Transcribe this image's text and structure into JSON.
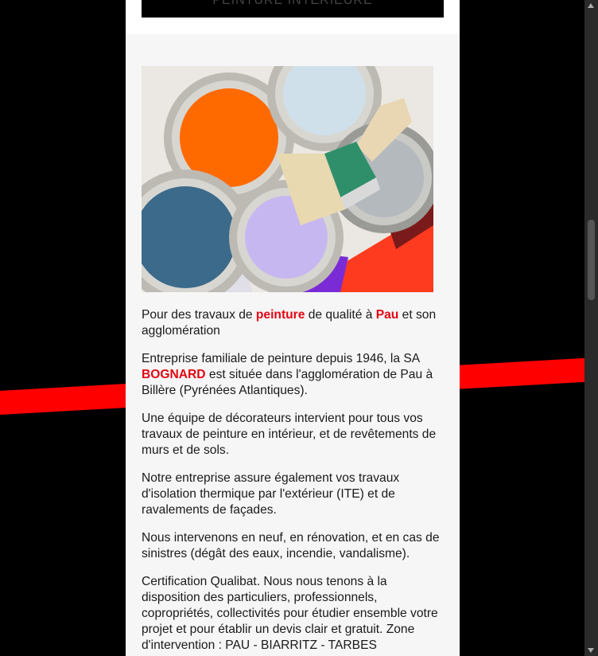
{
  "top_button": {
    "label": "PEINTURE INTÉRIEURE"
  },
  "hero_image": {
    "alt": "Pots de peinture et pinceau"
  },
  "content": {
    "p1": {
      "t1": "Pour des travaux de ",
      "h1": "peinture",
      "t2": " de qualité à ",
      "h2": "Pau",
      "t3": " et son agglomération"
    },
    "p2": {
      "t1": "Entreprise familiale de peinture depuis 1946, la SA ",
      "h1": "BOGNARD",
      "t2": " est située dans l'agglomération de Pau à Billère (Pyrénées Atlantiques)."
    },
    "p3": "Une équipe de décorateurs intervient pour tous vos travaux de peinture en intérieur, et de revêtements de murs et de sols.",
    "p4": "Notre entreprise assure également vos travaux d'isolation thermique par l'extérieur (ITE) et de ravalements de façades.",
    "p5": "Nous intervenons en neuf, en rénovation, et en cas de sinistres (dégât des eaux, incendie, vandalisme).",
    "p6": "Certification Qualibat. Nous nous tenons à la disposition des particuliers, professionnels, copropriétés, collectivités pour étudier ensemble votre projet et pour établir un devis clair et gratuit. Zone d'intervention : PAU - BIARRITZ - TARBES"
  },
  "colors": {
    "accent": "#e30613",
    "stripe": "#ff0000"
  }
}
